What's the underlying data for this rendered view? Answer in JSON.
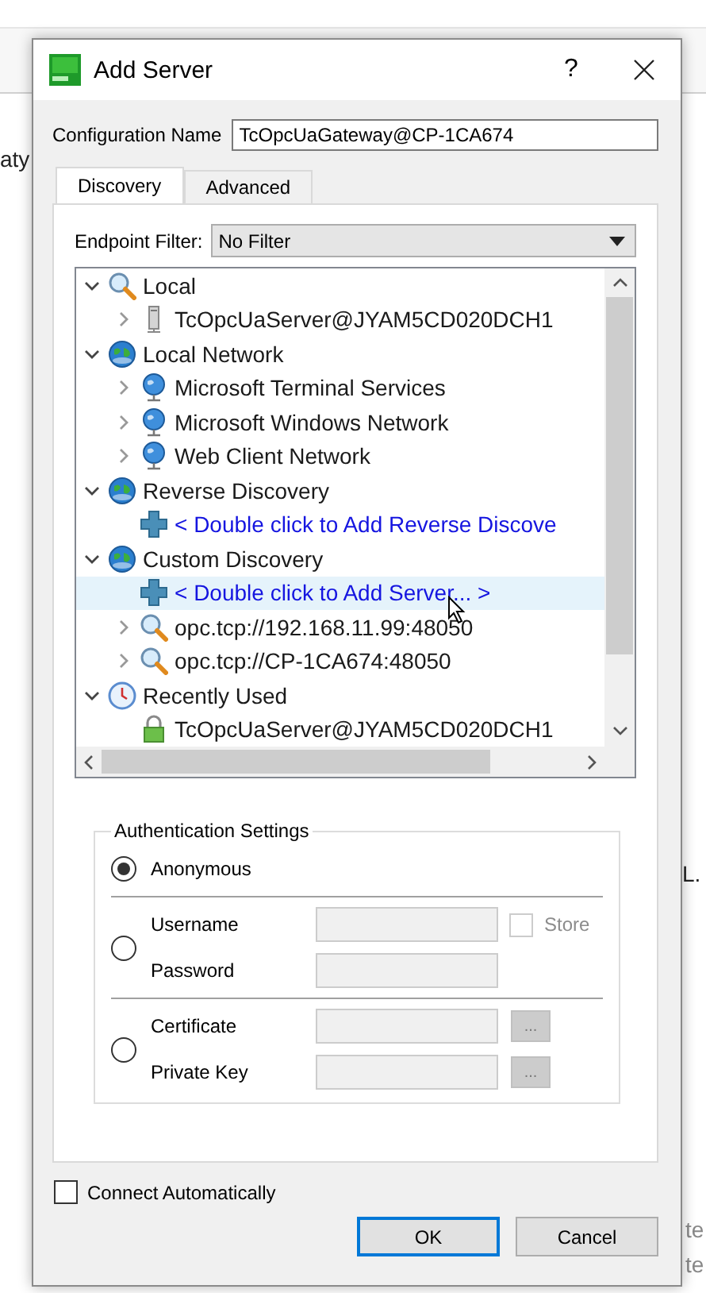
{
  "background_texts": [
    "aty",
    "L.",
    "te",
    "te"
  ],
  "dialog": {
    "title": "Add Server",
    "help": "?"
  },
  "config_name": {
    "label": "Configuration Name",
    "value": "TcOpcUaGateway@CP-1CA674"
  },
  "tabs": [
    {
      "label": "Discovery",
      "selected": true
    },
    {
      "label": "Advanced",
      "selected": false
    }
  ],
  "endpoint_filter": {
    "label": "Endpoint Filter:",
    "value": "No Filter"
  },
  "tree": [
    {
      "label": "Local",
      "kind": "search",
      "selected": false,
      "expanded": true,
      "children": [
        {
          "label": "TcOpcUaServer@JYAM5CD020DCH1",
          "kind": "server",
          "selected": false,
          "expanded": false
        }
      ]
    },
    {
      "label": "Local Network",
      "kind": "globe",
      "selected": false,
      "expanded": true,
      "children": [
        {
          "label": "Microsoft Terminal Services",
          "kind": "network",
          "selected": false,
          "expanded": false
        },
        {
          "label": "Microsoft Windows Network",
          "kind": "network",
          "selected": false,
          "expanded": false
        },
        {
          "label": "Web Client Network",
          "kind": "network",
          "selected": false,
          "expanded": false
        }
      ]
    },
    {
      "label": "Reverse Discovery",
      "kind": "globe",
      "selected": false,
      "expanded": true,
      "children": [
        {
          "label": "< Double click to Add Reverse Discove",
          "kind": "add",
          "selected": false
        }
      ]
    },
    {
      "label": "Custom Discovery",
      "kind": "globe",
      "selected": false,
      "expanded": true,
      "children": [
        {
          "label": "< Double click to Add Server... >",
          "kind": "add",
          "selected": true
        },
        {
          "label": "opc.tcp://192.168.11.99:48050",
          "kind": "search",
          "selected": false,
          "expanded": false
        },
        {
          "label": "opc.tcp://CP-1CA674:48050",
          "kind": "search",
          "selected": false,
          "expanded": false
        }
      ]
    },
    {
      "label": "Recently Used",
      "kind": "clock",
      "selected": false,
      "expanded": true,
      "children": [
        {
          "label": "TcOpcUaServer@JYAM5CD020DCH1",
          "kind": "lock",
          "selected": false
        }
      ]
    }
  ],
  "auth": {
    "title": "Authentication Settings",
    "options": [
      {
        "kind": "anonymous",
        "selected": true,
        "fields": [
          {
            "label": "Anonymous"
          }
        ]
      },
      {
        "kind": "credentials",
        "selected": false,
        "fields": [
          {
            "label": "Username"
          },
          {
            "label": "Password"
          }
        ],
        "store": {
          "label": "Store",
          "checked": false,
          "disabled": true
        }
      },
      {
        "kind": "files",
        "selected": false,
        "fields": [
          {
            "label": "Certificate",
            "browse": "..."
          },
          {
            "label": "Private Key",
            "browse": "..."
          }
        ]
      }
    ]
  },
  "connect_automatically": {
    "label": "Connect Automatically",
    "checked": false
  },
  "buttons": [
    {
      "label": "OK",
      "default": true
    },
    {
      "label": "Cancel",
      "default": false
    }
  ]
}
